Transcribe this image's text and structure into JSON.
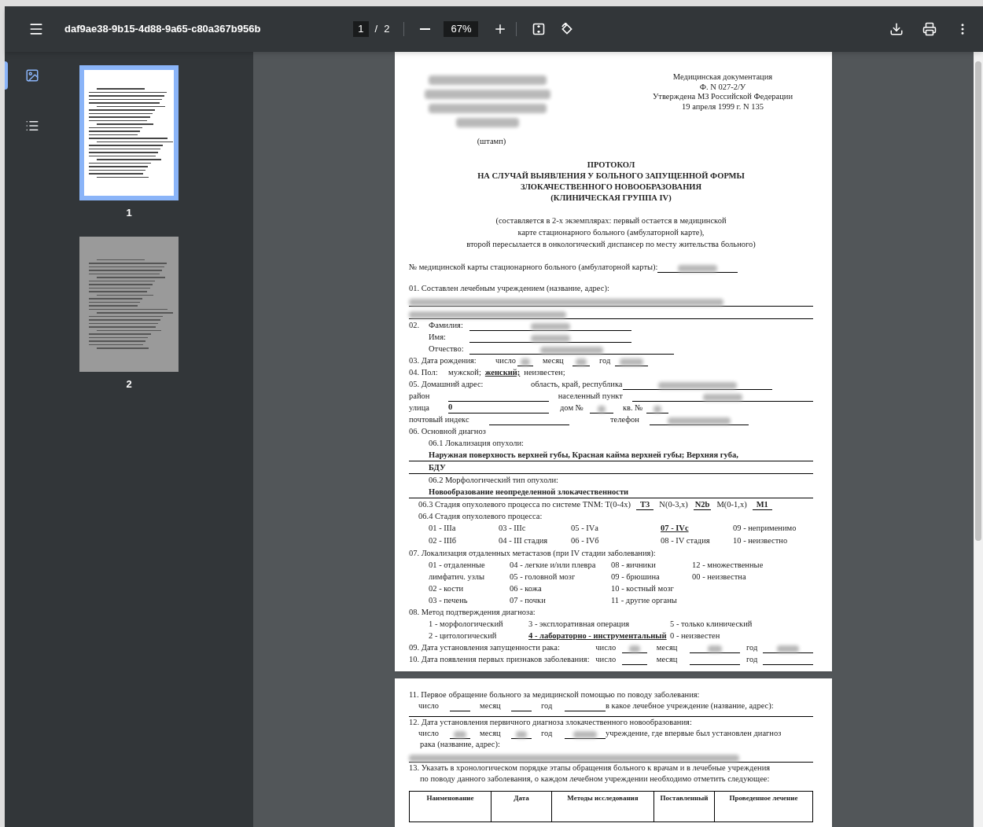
{
  "toolbar": {
    "title": "daf9ae38-9b15-4d88-9a65-c80a367b956b",
    "page_current": "1",
    "page_separator": "/",
    "page_total": "2",
    "zoom": "67%"
  },
  "sidebar": {
    "views": [
      {
        "kind": "thumbnails",
        "selected": true
      },
      {
        "kind": "outline",
        "selected": false
      }
    ],
    "thumbnails": [
      {
        "label": "1",
        "selected": true
      },
      {
        "label": "2",
        "selected": false
      }
    ]
  },
  "page1": {
    "header_lines": [
      "Медицинская документация",
      "Ф. N 027-2/У",
      "Утверждена МЗ Российской Федерации",
      "19 апреля 1999 г. N 135"
    ],
    "stamp": "(штамп)",
    "title_lines": [
      "ПРОТОКОЛ",
      "НА СЛУЧАЙ ВЫЯВЛЕНИЯ У БОЛЬНОГО ЗАПУЩЕННОЙ ФОРМЫ",
      "ЗЛОКАЧЕСТВЕННОГО НОВООБРАЗОВАНИЯ",
      "(КЛИНИЧЕСКАЯ ГРУППА IV)"
    ],
    "note_lines": [
      "(составляется в 2-х экземплярах: первый остается в медицинской",
      "карте стационарного больного (амбулаторной карте),",
      "второй пересылается в онкологический диспансер по месту жительства больного)"
    ],
    "card_number_label": "№ медицинской карты стационарного больного (амбулаторной карты):",
    "s01_label": "01. Составлен лечебным учреждением (название, адрес):",
    "s02_number": "02.",
    "s02_fields": [
      "Фамилия:",
      "Имя:",
      "Отчество:"
    ],
    "s03": {
      "label": "03. Дата рождения:",
      "day": "число",
      "month": "месяц",
      "year": "год"
    },
    "s04": {
      "label": "04. Пол:",
      "options": [
        {
          "text": "мужской;",
          "selected": false
        },
        {
          "text": "женский;",
          "selected": true
        },
        {
          "text": "неизвестен;",
          "selected": false
        }
      ]
    },
    "s05": {
      "label": "05. Домашний адрес:",
      "region": "область, край, республика",
      "district": "район",
      "locality": "населенный пункт",
      "street": "улица",
      "street_value": "0",
      "house": "дом №",
      "apartment": "кв. №",
      "postal": "почтовый индекс",
      "phone": "телефон"
    },
    "s06": {
      "label": "06. Основной диагноз",
      "localization_label": "06.1 Локализация опухоли:",
      "localization_lines": [
        "Наружная поверхность верхней губы, Красная кайма верхней губы; Верхняя губа,",
        "БДУ"
      ],
      "morphology_label": "06.2 Морфологический тип опухоли:",
      "morphology_value": "Новообразование неопределенной злокачественности",
      "tnm_label": "06.3 Стадия опухолевого процесса по системе TNM: T(0-4x)",
      "t_value": "T3",
      "n_label": "N(0-3,x)",
      "n_value": "N2b",
      "m_label": "M(0-1,x)",
      "m_value": "M1",
      "stage_label": "06.4 Стадия опухолевого процесса:",
      "stages": [
        {
          "text": "01 - IIIа",
          "selected": false
        },
        {
          "text": "03 - IIIс",
          "selected": false
        },
        {
          "text": "05 - IVа",
          "selected": false
        },
        {
          "text": "07 - IVс",
          "selected": true
        },
        {
          "text": "09 - неприменимо",
          "selected": false
        },
        {
          "text": "02 - IIIб",
          "selected": false
        },
        {
          "text": "04 - III стадия",
          "selected": false
        },
        {
          "text": "06 - IVб",
          "selected": false
        },
        {
          "text": "08 - IV стадия",
          "selected": false
        },
        {
          "text": "10 - неизвестно",
          "selected": false
        }
      ]
    },
    "s07": {
      "label": "07. Локализация отдаленных метастазов (при IV стадии заболевания):",
      "rows": [
        [
          "01 - отдаленные",
          "04 - легкие и/или плевра",
          "08 - яичники",
          "12 - множественные"
        ],
        [
          "лимфатич. узлы",
          "05 - головной мозг",
          "09 - брюшина",
          "00 - неизвестна"
        ],
        [
          "02 - кости",
          "06 - кожа",
          "10 - костный мозг"
        ],
        [
          "03 - печень",
          "07 - почки",
          "11 - другие органы"
        ]
      ]
    },
    "s08": {
      "label": "08. Метод подтверждения диагноза:",
      "rows": [
        [
          {
            "text": "1 - морфологический",
            "selected": false
          },
          {
            "text": "3 - эксплоративная операция",
            "selected": false
          },
          {
            "text": "5 - только клинический",
            "selected": false
          }
        ],
        [
          {
            "text": "2 - цитологический",
            "selected": false
          },
          {
            "text": "4 - лабораторно - инструментальный",
            "selected": true
          },
          {
            "text": "0 - неизвестен",
            "selected": false
          }
        ]
      ]
    },
    "s09": {
      "label": "09. Дата установления запущенности рака:",
      "day": "число",
      "month": "месяц",
      "year": "год"
    },
    "s10": {
      "label": "10. Дата появления первых признаков заболевания:",
      "day": "число",
      "month": "месяц",
      "year": "год"
    }
  },
  "page2": {
    "s11": {
      "label": "11. Первое обращение больного за медицинской помощью по поводу заболевания:",
      "day": "число",
      "month": "месяц",
      "year": "год",
      "institution": "в какое лечебное учреждение (название,   адрес):"
    },
    "s12": {
      "label": "12. Дата установления первичного диагноза злокачественного новообразования:",
      "day": "число",
      "month": "месяц",
      "year": "год",
      "institution": "учреждение, где впервые был установлен диагноз",
      "institution_cont": "рака (название, адрес):"
    },
    "s13_lines": [
      "13. Указать в хронологическом порядке этапы обращения больного к врачам и в лечебные учреждения",
      "по поводу данного заболевания, о каждом лечебном учреждении необходимо отметить следующее:"
    ],
    "table_columns": [
      "Наименование",
      "Дата",
      "Методы исследования",
      "Поставленный",
      "Проведенное лечение"
    ]
  }
}
